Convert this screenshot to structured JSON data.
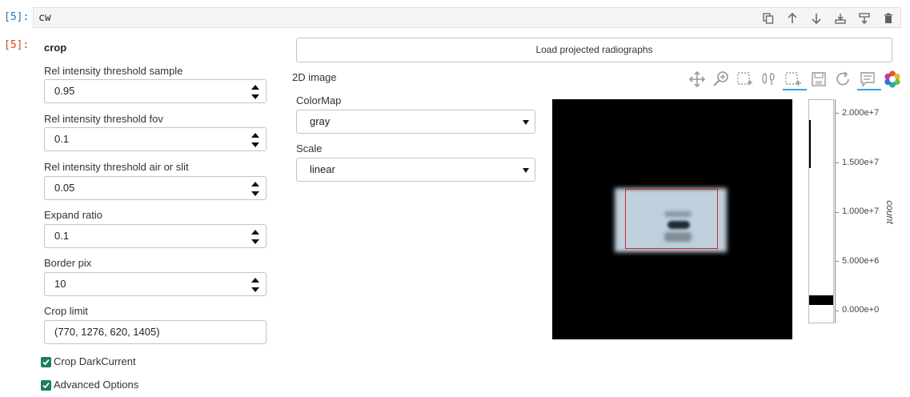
{
  "cell_in": {
    "prompt": "[5]:",
    "code": "cw",
    "toolbar": [
      "duplicate-icon",
      "move-up-icon",
      "move-down-icon",
      "insert-above-icon",
      "insert-below-icon",
      "delete-icon"
    ]
  },
  "cell_out": {
    "prompt": "[5]:",
    "section_title": "crop",
    "fields": [
      {
        "label": "Rel intensity threshold sample",
        "value": "0.95"
      },
      {
        "label": "Rel intensity threshold fov",
        "value": "0.1"
      },
      {
        "label": "Rel intensity threshold air or slit",
        "value": "0.05"
      },
      {
        "label": "Expand ratio",
        "value": "0.1"
      },
      {
        "label": "Border pix",
        "value": "10"
      }
    ],
    "crop_limit": {
      "label": "Crop limit",
      "value": "(770, 1276, 620, 1405)"
    },
    "checkboxes": [
      {
        "label": "Crop DarkCurrent",
        "checked": true
      },
      {
        "label": "Advanced Options",
        "checked": true
      }
    ],
    "load_button": "Load projected radiographs",
    "image_panel": {
      "title": "2D image",
      "colormap": {
        "label": "ColorMap",
        "value": "gray"
      },
      "scale": {
        "label": "Scale",
        "value": "linear"
      },
      "toolbar": [
        "pan-icon",
        "wheel-zoom-icon",
        "box-zoom-icon",
        "lasso-icon",
        "box-edit-icon",
        "save-icon",
        "reset-icon",
        "hover-icon",
        "bokeh-logo-icon"
      ],
      "colorbar": {
        "ticks": [
          "2.000e+7",
          "1.500e+7",
          "1.000e+7",
          "5.000e+6",
          "0.000e+0"
        ],
        "axis_label": "count"
      }
    },
    "accent_colors": {
      "checkbox": "#1b7f5a",
      "crop_rect": "#d62728",
      "toolbar_active": "#26aae1"
    }
  }
}
